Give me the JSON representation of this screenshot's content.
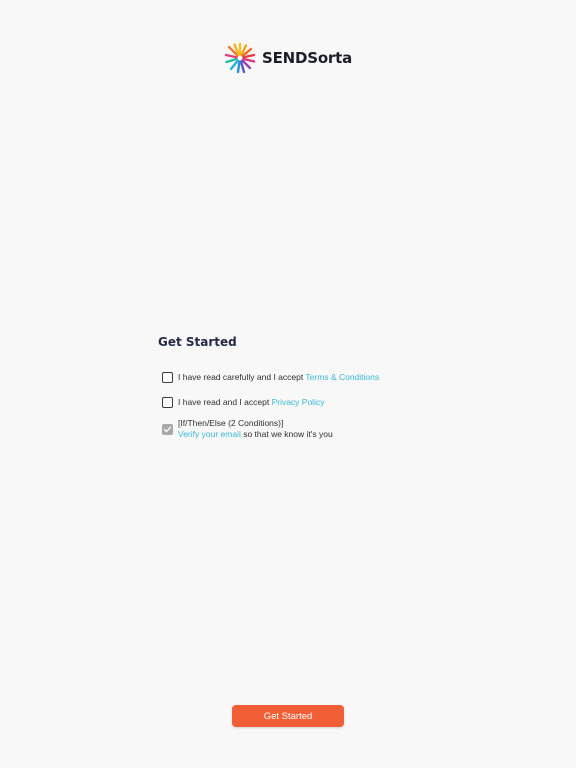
{
  "header": {
    "logo_icon": "sendsorta-burst-logo-icon",
    "brand": "SENDSorta"
  },
  "main": {
    "title": "Get Started",
    "items": [
      {
        "prefix": "I have read carefully and I accept ",
        "link": "Terms & Conditions",
        "checked": false
      },
      {
        "prefix": "I have read and I accept ",
        "link": "Privacy Policy",
        "checked": false
      },
      {
        "line1": "[If/Then/Else (2 Conditions)]",
        "link": "Verify your email",
        "suffix": " so that we know it's you",
        "checked": true
      }
    ]
  },
  "footer": {
    "button_label": "Get Started"
  },
  "colors": {
    "accent_link": "#3bb7d8",
    "button": "#f15f37",
    "title": "#232a45",
    "background": "#f8f8f8"
  }
}
